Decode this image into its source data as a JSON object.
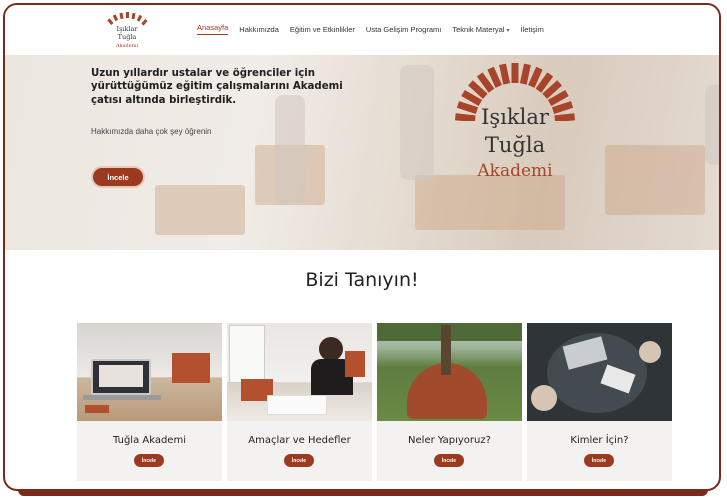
{
  "brand": {
    "logo_line1": "Işıklar",
    "logo_line2": "Tuğla",
    "logo_line3": "Akademi"
  },
  "nav": {
    "items": [
      {
        "label": "Anasayfa",
        "active": true
      },
      {
        "label": "Hakkımızda",
        "active": false
      },
      {
        "label": "Eğitim ve Etkinlikler",
        "active": false
      },
      {
        "label": "Usta Gelişim Programı",
        "active": false
      },
      {
        "label": "Teknik Materyal",
        "active": false,
        "dropdown": true
      },
      {
        "label": "İletişim",
        "active": false
      }
    ]
  },
  "hero": {
    "title": "Uzun yıllardır ustalar ve öğrenciler için yürüttüğümüz eğitim çalışmalarını Akademi çatısı altında birleştirdik.",
    "subtitle": "Hakkımızda daha çok şey öğrenin",
    "button": "İncele"
  },
  "section": {
    "title": "Bizi Tanıyın!"
  },
  "cards": [
    {
      "title": "Tuğla Akademi",
      "button": "İncele"
    },
    {
      "title": "Amaçlar ve Hedefler",
      "button": "İncele"
    },
    {
      "title": "Neler Yapıyoruz?",
      "button": "İncele"
    },
    {
      "title": "Kimler İçin?",
      "button": "İncele"
    }
  ],
  "colors": {
    "accent": "#9c3a1f",
    "frame": "#7a2a1a",
    "text": "#222222"
  }
}
